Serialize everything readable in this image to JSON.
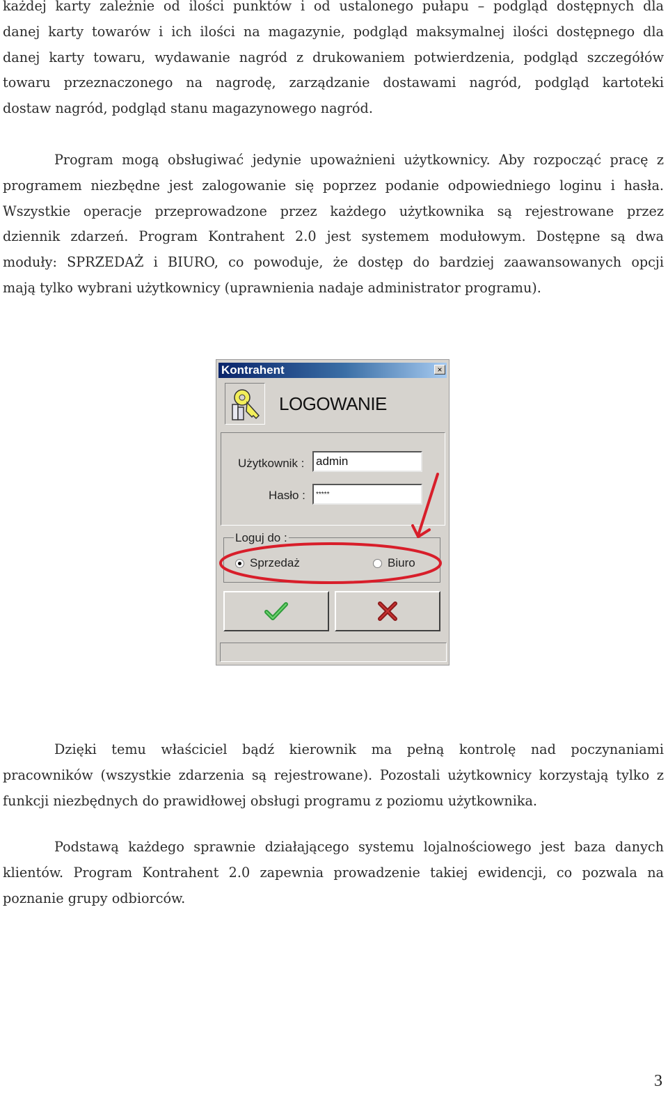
{
  "paragraph1": {
    "lines": [
      "każdej karty zależnie od ilości punktów i od ustalonego pułapu – podgląd dostępnych dla",
      "danej karty towarów i ich ilości na magazynie, podgląd maksymalnej ilości dostępnego dla",
      "danej karty towaru, wydawanie nagród z drukowaniem potwierdzenia, podgląd szczegółów",
      "towaru przeznaczonego na nagrodę, zarządzanie dostawami nagród, podgląd kartoteki",
      "dostaw nagród, podgląd stanu magazynowego nagród."
    ]
  },
  "paragraph2": {
    "lines": [
      "Program mogą obsługiwać jedynie upoważnieni użytkownicy. Aby rozpocząć pracę z",
      "programem niezbędne jest zalogowanie się poprzez podanie odpowiedniego loginu i hasła.",
      "Wszystkie operacje przeprowadzone przez każdego użytkownika są rejestrowane przez",
      "dziennik zdarzeń. Program Kontrahent 2.0 jest systemem modułowym. Dostępne są dwa",
      "moduły: SPRZEDAŻ i BIURO, co powoduje, że dostęp do bardziej zaawansowanych opcji",
      "mają tylko wybrani użytkownicy (uprawnienia nadaje administrator programu)."
    ]
  },
  "dialog": {
    "window_title": "Kontrahent",
    "close_glyph": "×",
    "heading": "LOGOWANIE",
    "username_label": "Użytkownik :",
    "username_value": "admin",
    "password_label": "Hasło :",
    "password_value": "*****",
    "group_label": "Loguj do :",
    "options": [
      {
        "label": "Sprzedaż",
        "checked": true
      },
      {
        "label": "Biuro",
        "checked": false
      }
    ],
    "ok_icon": "green-checkmark-icon",
    "cancel_icon": "red-x-icon",
    "colors": {
      "title_bar_start": "#0a246a",
      "title_bar_end": "#a6caf0",
      "window_bg": "#d6d3ce",
      "annotation_red": "#d81e2a",
      "ok_green": "#2e9b3a",
      "cancel_red": "#8b1a1a"
    }
  },
  "paragraph3": {
    "lines": [
      "Dzięki temu właściciel bądź kierownik ma pełną kontrolę nad poczynaniami",
      "pracowników (wszystkie zdarzenia są rejestrowane). Pozostali użytkownicy korzystają tylko z",
      "funkcji niezbędnych do prawidłowej obsługi programu z poziomu użytkownika."
    ]
  },
  "paragraph4": {
    "lines": [
      "Podstawą każdego sprawnie działającego systemu lojalnościowego jest baza danych",
      "klientów. Program Kontrahent 2.0 zapewnia prowadzenie takiej ewidencji, co pozwala na",
      "poznanie grupy odbiorców."
    ]
  },
  "page_number": "3"
}
